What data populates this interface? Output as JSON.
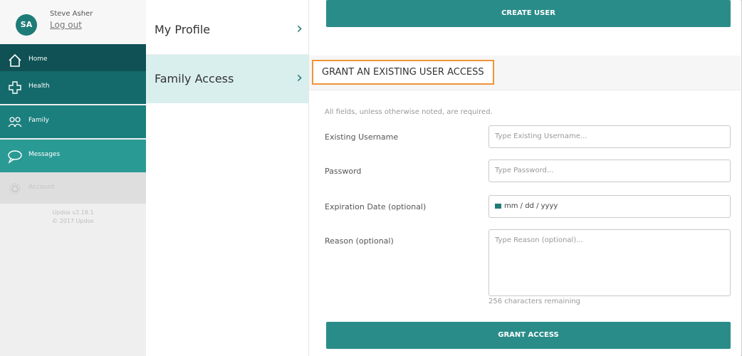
{
  "user": {
    "initials": "SA",
    "name": "Steve Asher",
    "logout": "Log out"
  },
  "nav": {
    "items": [
      {
        "label": "Home",
        "icon": "home-icon"
      },
      {
        "label": "Health",
        "icon": "health-cross-icon"
      },
      {
        "label": "Family",
        "icon": "family-icon"
      },
      {
        "label": "Messages",
        "icon": "message-bubble-icon"
      },
      {
        "label": "Account",
        "icon": "gear-icon"
      }
    ],
    "footer_line1": "Updox v2.18.1",
    "footer_line2": "© 2017 Updox"
  },
  "mid": {
    "items": [
      {
        "label": "My Profile"
      },
      {
        "label": "Family Access"
      }
    ]
  },
  "content": {
    "create_button": "CREATE USER",
    "section_title": "GRANT AN EXISTING USER ACCESS",
    "note": "All fields, unless otherwise noted, are required.",
    "fields": {
      "username_label": "Existing Username",
      "username_placeholder": "Type Existing Username...",
      "password_label": "Password",
      "password_placeholder": "Type Password...",
      "date_label": "Expiration Date (optional)",
      "date_placeholder": "mm / dd / yyyy",
      "reason_label": "Reason (optional)",
      "reason_placeholder": "Type Reason (optional)..."
    },
    "remaining": "256 characters remaining",
    "grant_button": "GRANT ACCESS"
  },
  "colors": {
    "teal_dark": "#0f5154",
    "teal": "#2a8c89",
    "highlight_orange": "#f0943a"
  }
}
